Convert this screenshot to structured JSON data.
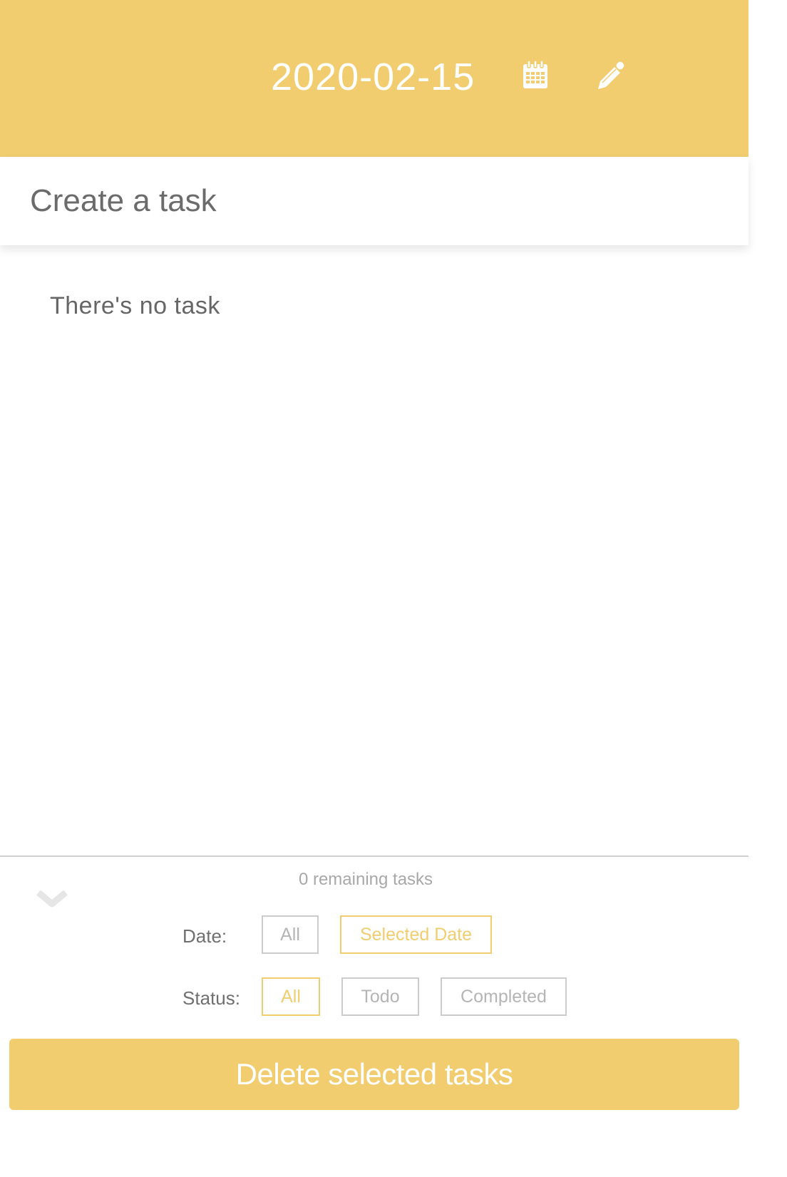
{
  "header": {
    "date": "2020-02-15",
    "calendar_icon": "calendar-icon",
    "edit_icon": "pencil-icon"
  },
  "task_input": {
    "placeholder": "Create a task",
    "value": ""
  },
  "task_list": {
    "empty_message": "There's no task"
  },
  "footer": {
    "remaining_text": "0 remaining tasks",
    "collapse_icon": "chevron-down-icon",
    "date_filter": {
      "label": "Date:",
      "options": [
        {
          "label": "All",
          "selected": false
        },
        {
          "label": "Selected Date",
          "selected": true
        }
      ]
    },
    "status_filter": {
      "label": "Status:",
      "options": [
        {
          "label": "All",
          "selected": true
        },
        {
          "label": "Todo",
          "selected": false
        },
        {
          "label": "Completed",
          "selected": false
        }
      ]
    },
    "delete_button_label": "Delete selected tasks"
  },
  "colors": {
    "accent": "#f1cd70",
    "muted_border": "#cccccc",
    "muted_text": "#b5b5b5"
  }
}
